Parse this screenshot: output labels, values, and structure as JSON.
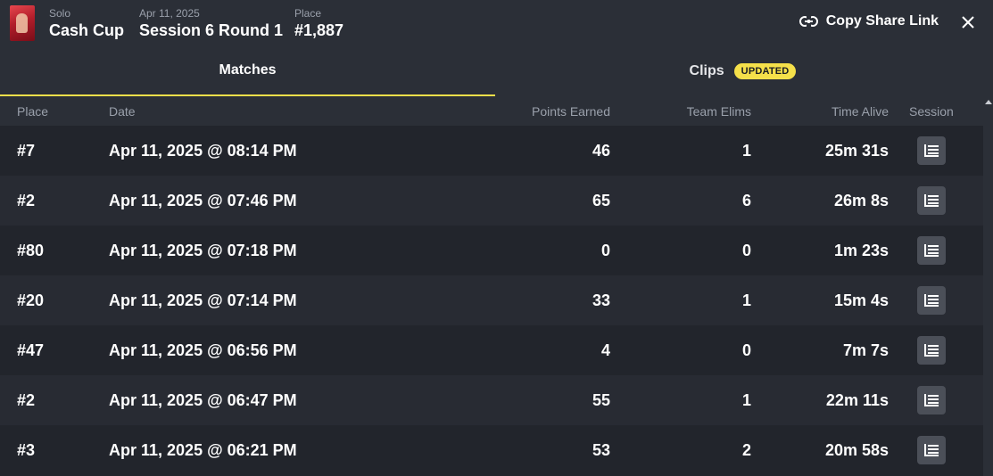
{
  "header": {
    "mode_label": "Solo",
    "event_name": "Cash Cup",
    "date_label": "Apr 11, 2025",
    "session_name": "Session 6 Round 1",
    "place_label": "Place",
    "place_value": "#1,887",
    "share_label": "Copy Share Link"
  },
  "tabs": {
    "matches": "Matches",
    "clips": "Clips",
    "clips_badge": "UPDATED"
  },
  "columns": {
    "place": "Place",
    "date": "Date",
    "points": "Points Earned",
    "elims": "Team Elims",
    "time": "Time Alive",
    "session": "Session"
  },
  "matches": [
    {
      "place": "#7",
      "date": "Apr 11, 2025 @ 08:14 PM",
      "points": "46",
      "elims": "1",
      "time": "25m 31s"
    },
    {
      "place": "#2",
      "date": "Apr 11, 2025 @ 07:46 PM",
      "points": "65",
      "elims": "6",
      "time": "26m 8s"
    },
    {
      "place": "#80",
      "date": "Apr 11, 2025 @ 07:18 PM",
      "points": "0",
      "elims": "0",
      "time": "1m 23s"
    },
    {
      "place": "#20",
      "date": "Apr 11, 2025 @ 07:14 PM",
      "points": "33",
      "elims": "1",
      "time": "15m 4s"
    },
    {
      "place": "#47",
      "date": "Apr 11, 2025 @ 06:56 PM",
      "points": "4",
      "elims": "0",
      "time": "7m 7s"
    },
    {
      "place": "#2",
      "date": "Apr 11, 2025 @ 06:47 PM",
      "points": "55",
      "elims": "1",
      "time": "22m 11s"
    },
    {
      "place": "#3",
      "date": "Apr 11, 2025 @ 06:21 PM",
      "points": "53",
      "elims": "2",
      "time": "20m 58s"
    }
  ],
  "icons": {
    "share": "link-icon",
    "close": "close-icon",
    "session": "session-details-icon"
  },
  "colors": {
    "accent": "#f5e04a",
    "background": "#22252c",
    "panel": "#2b2f37"
  }
}
